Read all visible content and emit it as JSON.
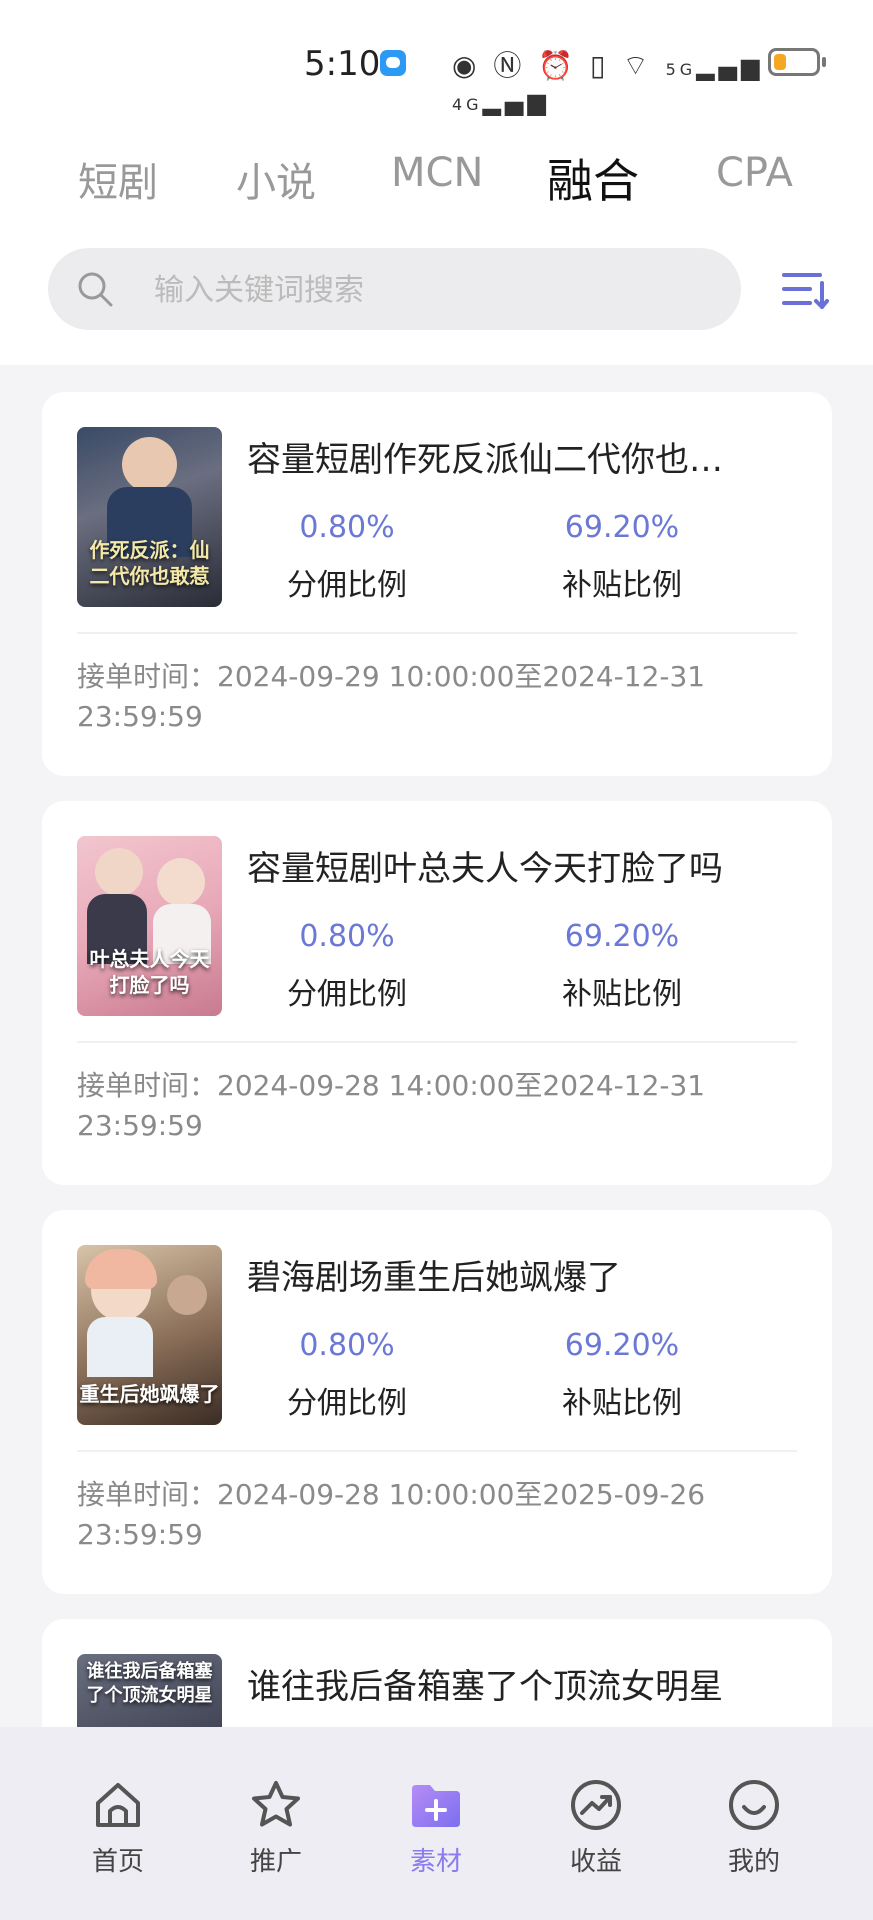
{
  "status_bar": {
    "time": "5:10",
    "network_labels": [
      "5G",
      "4G"
    ],
    "battery_color": "#f5a623"
  },
  "tabs": [
    {
      "label": "短剧",
      "active": false
    },
    {
      "label": "小说",
      "active": false
    },
    {
      "label": "MCN",
      "active": false
    },
    {
      "label": "融合",
      "active": true
    },
    {
      "label": "CPA",
      "active": false
    }
  ],
  "search": {
    "placeholder": "输入关键词搜索",
    "value": ""
  },
  "items": [
    {
      "title": "容量短剧作死反派仙二代你也…",
      "commission_value": "0.80%",
      "commission_label": "分佣比例",
      "subsidy_value": "69.20%",
      "subsidy_label": "补贴比例",
      "time_label": "接单时间：",
      "time_range": "2024-09-29 10:00:00至2024-12-31 23:59:59",
      "cover_text": "作死反派：仙二代你也敢惹"
    },
    {
      "title": "容量短剧叶总夫人今天打脸了吗",
      "commission_value": "0.80%",
      "commission_label": "分佣比例",
      "subsidy_value": "69.20%",
      "subsidy_label": "补贴比例",
      "time_label": "接单时间：",
      "time_range": "2024-09-28 14:00:00至2024-12-31 23:59:59",
      "cover_text": "叶总夫人今天打脸了吗"
    },
    {
      "title": "碧海剧场重生后她飒爆了",
      "commission_value": "0.80%",
      "commission_label": "分佣比例",
      "subsidy_value": "69.20%",
      "subsidy_label": "补贴比例",
      "time_label": "接单时间：",
      "time_range": "2024-09-28 10:00:00至2025-09-26 23:59:59",
      "cover_text": "重生后她飒爆了"
    },
    {
      "title": "谁往我后备箱塞了个顶流女明星",
      "commission_value": "",
      "commission_label": "",
      "subsidy_value": "",
      "subsidy_label": "",
      "time_label": "",
      "time_range": "",
      "cover_text": "谁往我后备箱塞了个顶流女明星"
    }
  ],
  "bottom_nav": [
    {
      "label": "首页",
      "icon": "home-icon",
      "active": false
    },
    {
      "label": "推广",
      "icon": "star-icon",
      "active": false
    },
    {
      "label": "素材",
      "icon": "folder-add-icon",
      "active": true
    },
    {
      "label": "收益",
      "icon": "trend-icon",
      "active": false
    },
    {
      "label": "我的",
      "icon": "smile-icon",
      "active": false
    }
  ],
  "colors": {
    "accent": "#8b7bf0",
    "stat_value": "#6b78d6",
    "filter_icon": "#6b6fd8"
  }
}
